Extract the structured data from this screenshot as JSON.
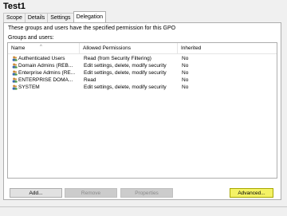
{
  "window": {
    "title": "Test1"
  },
  "tabs": [
    {
      "label": "Scope",
      "active": false
    },
    {
      "label": "Details",
      "active": false
    },
    {
      "label": "Settings",
      "active": false
    },
    {
      "label": "Delegation",
      "active": true
    }
  ],
  "delegation": {
    "description": "These groups and users have the specified permission for this GPO",
    "groups_label": "Groups and users:",
    "columns": [
      "Name",
      "Allowed Permissions",
      "Inherited"
    ],
    "rows": [
      {
        "name": "Authenticated Users",
        "permission": "Read (from Security Filtering)",
        "inherited": "No",
        "icon": "user-group-icon"
      },
      {
        "name": "Domain Admins (REB...",
        "permission": "Edit settings, delete, modify security",
        "inherited": "No",
        "icon": "user-group-icon"
      },
      {
        "name": "Enterprise Admins (RE...",
        "permission": "Edit settings, delete, modify security",
        "inherited": "No",
        "icon": "user-group-icon"
      },
      {
        "name": "ENTERPRISE DOMA...",
        "permission": "Read",
        "inherited": "No",
        "icon": "user-group-icon"
      },
      {
        "name": "SYSTEM",
        "permission": "Edit settings, delete, modify security",
        "inherited": "No",
        "icon": "user-group-icon"
      }
    ],
    "buttons": {
      "add": "Add...",
      "remove": "Remove",
      "properties": "Properties",
      "advanced": "Advanced..."
    }
  },
  "colors": {
    "advanced_highlight": "#f4f266",
    "panel_bg": "#ffffff",
    "window_bg": "#f0f0f0"
  }
}
